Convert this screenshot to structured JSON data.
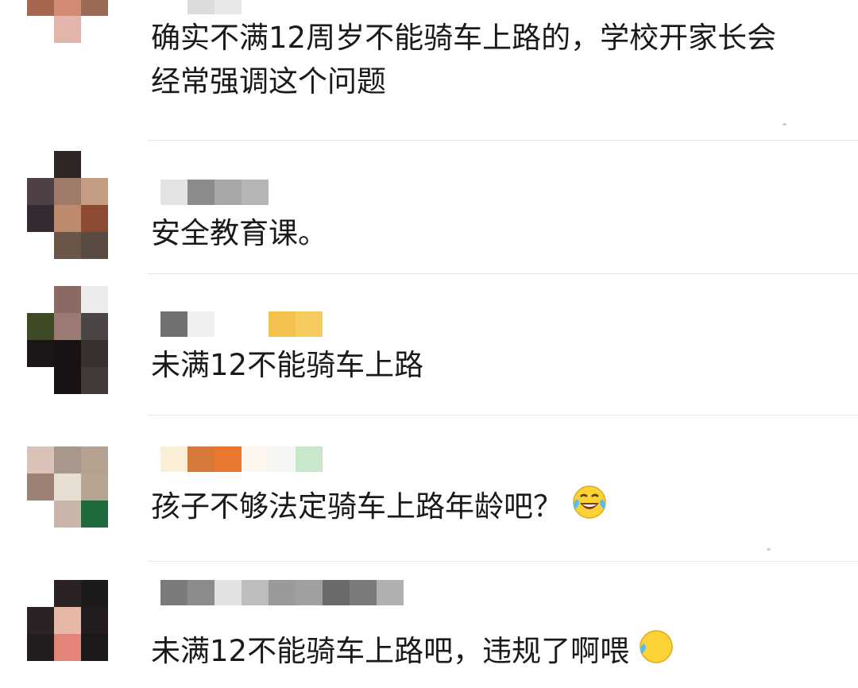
{
  "comments": [
    {
      "text": "确实不满12周岁不能骑车上路的，学校开家长会经常强调这个问题",
      "line1": "确实不满12周岁不能骑车上路的，学校开家长会",
      "line2": "经常强调这个问题",
      "avatar_colors": [
        "#a0785a",
        "#6e4a3a",
        "#3c2418",
        "#a5674e",
        "#d38a73",
        "#9a6a55",
        "#ffffff",
        "#e3b5aa",
        "#ffffff",
        "#ffffff",
        "#ffffff",
        "#ffffff"
      ],
      "name_colors": [
        "#ffffff",
        "#dcdcdc",
        "#e8e8e8",
        "#ffffff"
      ]
    },
    {
      "text": "安全教育课。",
      "avatar_colors": [
        "#ffffff",
        "#2f2626",
        "#ffffff",
        "#4e4046",
        "#9d7a6a",
        "#c49c82",
        "#332a32",
        "#bd8a6e",
        "#8e4b33",
        "#ffffff",
        "#6a5648",
        "#594a42"
      ],
      "name_colors": [
        "#e3e3e3",
        "#8b8b8b",
        "#a7a7a7",
        "#b6b6b6"
      ]
    },
    {
      "text": "未满12不能骑车上路",
      "avatar_colors": [
        "#ffffff",
        "#8a6a62",
        "#ececec",
        "#3e4a25",
        "#9a7a72",
        "#4b4546",
        "#1d1616",
        "#181212",
        "#3a2f2f",
        "#ffffff",
        "#1a1315",
        "#443a3a"
      ],
      "name_colors": [
        "#707070",
        "#f0f0f0",
        "#ffffff",
        "#ffffff",
        "#f4c24e",
        "#f6cc60"
      ]
    },
    {
      "text": "孩子不够法定骑车上路年龄吧？",
      "avatar_colors": [
        "#d9c3b8",
        "#a8978b",
        "#b4a18f",
        "#9c8076",
        "#e7ded3",
        "#b4a491",
        "#ffffff",
        "#c9b5aa",
        "#1f6a3d",
        "#ffffff",
        "#ffffff",
        "#ffffff"
      ],
      "name_colors": [
        "#fbeed7",
        "#d7793b",
        "#e8772f",
        "#fdf6ec",
        "#f6f6f4",
        "#c9e7cb"
      ],
      "emoji": "laughing-with-tears"
    },
    {
      "text": "未满12不能骑车上路吧，违规了啊喂",
      "avatar_colors": [
        "#ffffff",
        "#2a2225",
        "#1d1a1c",
        "#2a2223",
        "#e8b8a6",
        "#221c1e",
        "#231d1e",
        "#e2847a",
        "#1d1919",
        "#ffffff",
        "#ffffff",
        "#ffffff"
      ],
      "name_colors": [
        "#7a7a7a",
        "#8c8c8c",
        "#e2e2e2",
        "#bdbdbd",
        "#9a9a9a",
        "#a0a0a0",
        "#6a6a6a",
        "#7a7a7a",
        "#b0b0b0"
      ],
      "emoji": "laughing-with-tears"
    }
  ]
}
